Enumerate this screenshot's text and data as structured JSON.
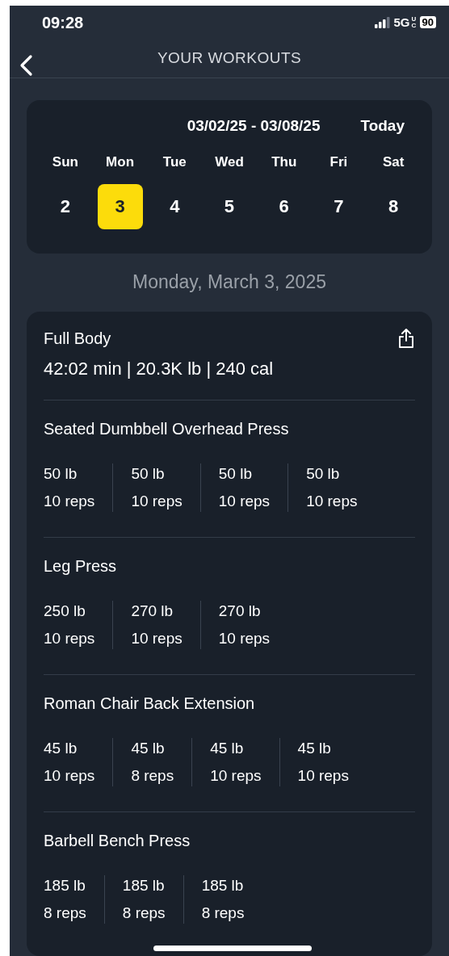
{
  "status_bar": {
    "time": "09:28",
    "network": "5G",
    "network_sub": "UC",
    "battery": "90"
  },
  "header": {
    "title": "YOUR WORKOUTS"
  },
  "week": {
    "range": "03/02/25 - 03/08/25",
    "today_button": "Today",
    "days": [
      {
        "weekday": "Sun",
        "date": "2",
        "selected": false
      },
      {
        "weekday": "Mon",
        "date": "3",
        "selected": true
      },
      {
        "weekday": "Tue",
        "date": "4",
        "selected": false
      },
      {
        "weekday": "Wed",
        "date": "5",
        "selected": false
      },
      {
        "weekday": "Thu",
        "date": "6",
        "selected": false
      },
      {
        "weekday": "Fri",
        "date": "7",
        "selected": false
      },
      {
        "weekday": "Sat",
        "date": "8",
        "selected": false
      }
    ]
  },
  "selected_date": "Monday, March 3, 2025",
  "workout": {
    "title": "Full Body",
    "summary": "42:02 min | 20.3K lb | 240 cal",
    "exercises": [
      {
        "name": "Seated Dumbbell Overhead Press",
        "sets": [
          {
            "weight": "50 lb",
            "reps": "10 reps"
          },
          {
            "weight": "50 lb",
            "reps": "10 reps"
          },
          {
            "weight": "50 lb",
            "reps": "10 reps"
          },
          {
            "weight": "50 lb",
            "reps": "10 reps"
          }
        ]
      },
      {
        "name": "Leg Press",
        "sets": [
          {
            "weight": "250 lb",
            "reps": "10 reps"
          },
          {
            "weight": "270 lb",
            "reps": "10 reps"
          },
          {
            "weight": "270 lb",
            "reps": "10 reps"
          }
        ]
      },
      {
        "name": "Roman Chair Back Extension",
        "sets": [
          {
            "weight": "45 lb",
            "reps": "10 reps"
          },
          {
            "weight": "45 lb",
            "reps": "8 reps"
          },
          {
            "weight": "45 lb",
            "reps": "10 reps"
          },
          {
            "weight": "45 lb",
            "reps": "10 reps"
          }
        ]
      },
      {
        "name": "Barbell Bench Press",
        "sets": [
          {
            "weight": "185 lb",
            "reps": "8 reps"
          },
          {
            "weight": "185 lb",
            "reps": "8 reps"
          },
          {
            "weight": "185 lb",
            "reps": "8 reps"
          }
        ]
      }
    ]
  }
}
